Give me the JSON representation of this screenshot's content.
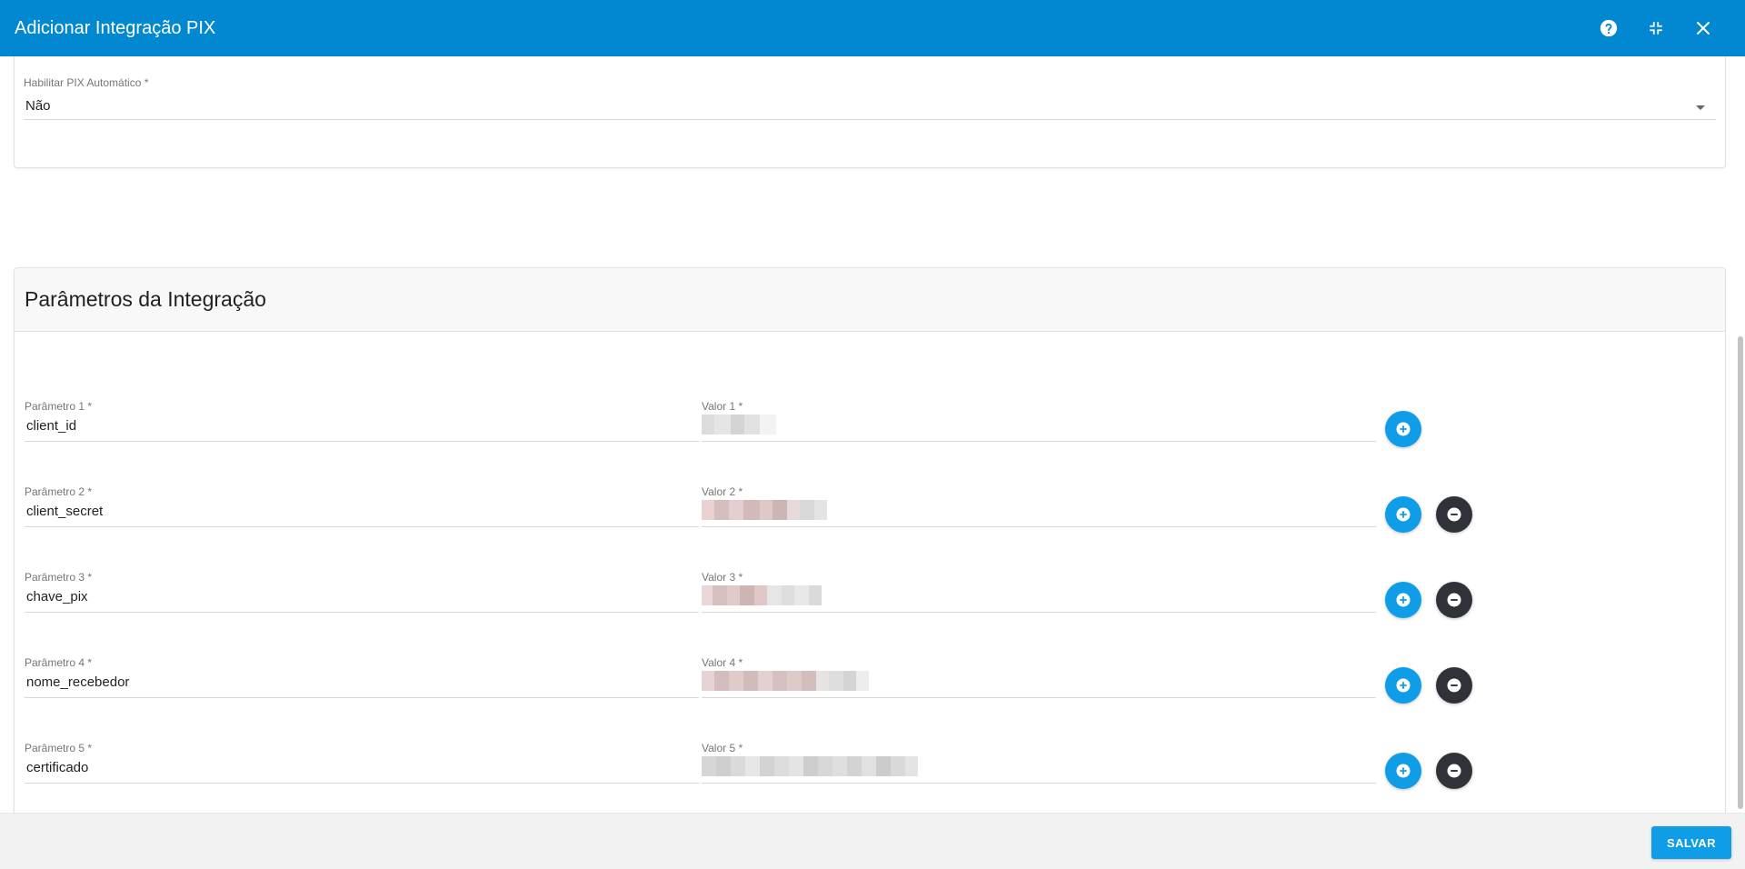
{
  "window": {
    "title": "Adicionar Integração PIX",
    "icons": [
      "help-icon",
      "collapse-icon",
      "close-icon"
    ]
  },
  "auto_pix": {
    "label": "Habilitar PIX Automático *",
    "value": "Não"
  },
  "params_section": {
    "title": "Parâmetros da Integração",
    "rows": [
      {
        "param_label": "Parâmetro 1 *",
        "param_value": "client_id",
        "value_label": "Valor 1 *",
        "value_redacted": true,
        "removable": false
      },
      {
        "param_label": "Parâmetro 2 *",
        "param_value": "client_secret",
        "value_label": "Valor 2 *",
        "value_redacted": true,
        "removable": true
      },
      {
        "param_label": "Parâmetro 3 *",
        "param_value": "chave_pix",
        "value_label": "Valor 3 *",
        "value_redacted": true,
        "removable": true
      },
      {
        "param_label": "Parâmetro 4 *",
        "param_value": "nome_recebedor",
        "value_label": "Valor 4 *",
        "value_redacted": true,
        "removable": true
      },
      {
        "param_label": "Parâmetro 5 *",
        "param_value": "certificado",
        "value_label": "Valor 5 *",
        "value_redacted": true,
        "removable": true
      }
    ]
  },
  "footer": {
    "save_label": "SALVAR"
  },
  "colors": {
    "header": "#0288d1",
    "add_button": "#0e9de6",
    "remove_button": "#2f3339",
    "save_button": "#0e9de6"
  }
}
